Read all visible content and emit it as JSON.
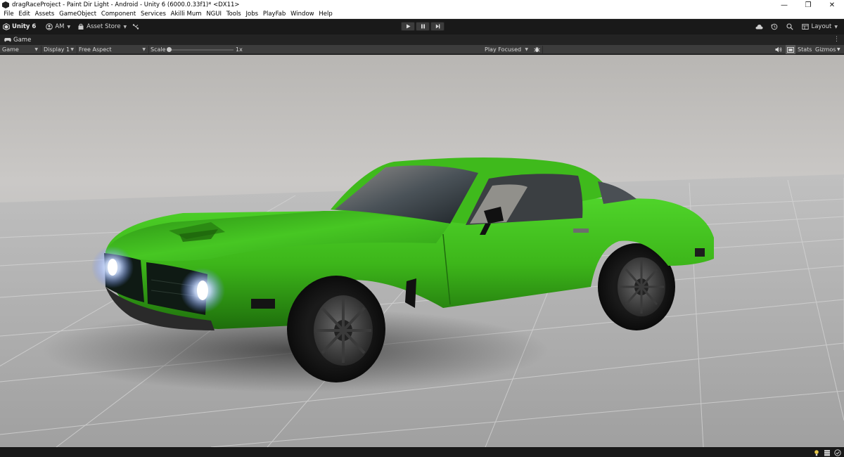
{
  "window": {
    "title": "dragRaceProject - Paint Dir Light - Android - Unity 6 (6000.0.33f1)* <DX11>",
    "controls": {
      "minimize": "—",
      "restore": "❐",
      "close": "✕"
    }
  },
  "menu": [
    "File",
    "Edit",
    "Assets",
    "GameObject",
    "Component",
    "Services",
    "Akilli Mum",
    "NGUI",
    "Tools",
    "Jobs",
    "PlayFab",
    "Window",
    "Help"
  ],
  "toolbar": {
    "unity_label": "Unity 6",
    "account_label": "AM",
    "asset_store_label": "Asset Store",
    "layout_label": "Layout"
  },
  "tabs": {
    "game_label": "Game",
    "menu_glyph": "⋮"
  },
  "game_bar": {
    "view_mode": "Game",
    "display": "Display 1",
    "aspect": "Free Aspect",
    "scale_label": "Scale",
    "scale_value": 0.0,
    "scale_readout": "1x",
    "play_mode": "Play Focused",
    "stats_label": "Stats",
    "gizmos_label": "Gizmos"
  },
  "scene": {
    "car_color": "#3db61a",
    "headlight_color": "#cfe0ff",
    "floor_color": "#a9a9a9",
    "sky_color": "#c6c4c1"
  },
  "icons": {
    "account": "account-icon",
    "asset_store": "asset-store-icon",
    "version_control": "version-control-icon",
    "cloud": "cloud-icon",
    "history": "history-icon",
    "search": "search-icon",
    "layout": "layout-icon",
    "play": "play-icon",
    "pause": "pause-icon",
    "step": "step-icon",
    "audio": "audio-icon",
    "aspect": "aspect-icon",
    "bug": "bug-icon"
  },
  "colors": {
    "accent": "#3c3c3c",
    "toolbar_bg": "#191919",
    "menu_bg": "#ffffff"
  }
}
